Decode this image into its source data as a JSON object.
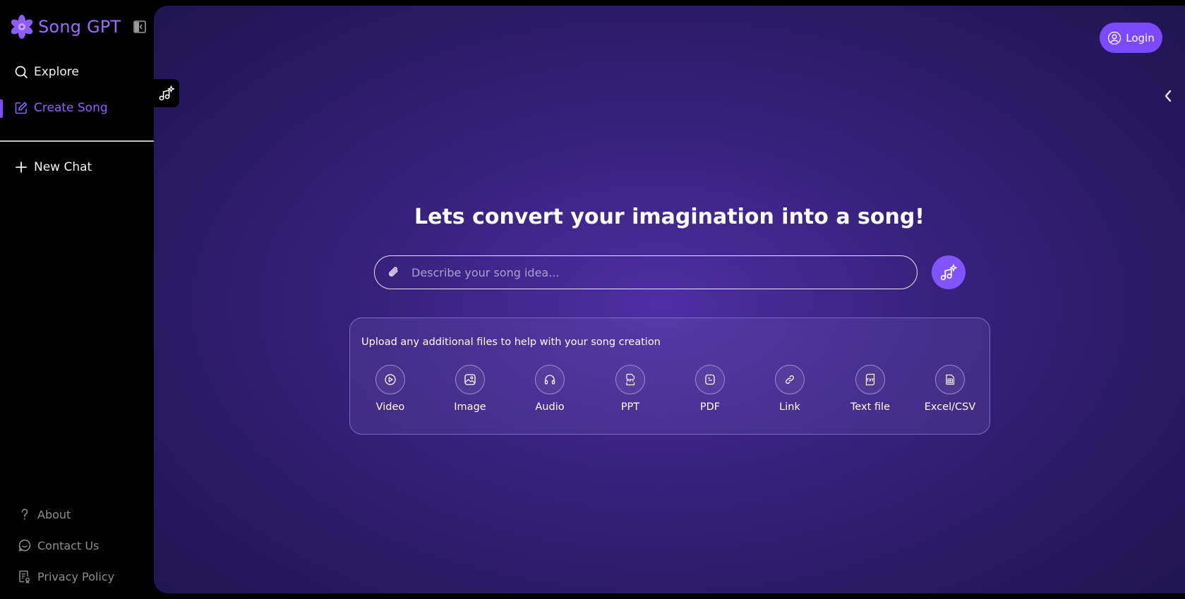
{
  "brand": {
    "name": "Song GPT"
  },
  "sidebar": {
    "items": [
      {
        "label": "Explore",
        "icon": "search-icon"
      },
      {
        "label": "Create Song",
        "icon": "edit-icon",
        "active": true
      }
    ],
    "new_chat": {
      "label": "New Chat",
      "icon": "plus-icon"
    },
    "footer": [
      {
        "label": "About",
        "icon": "question-icon"
      },
      {
        "label": "Contact Us",
        "icon": "chat-bubble-icon"
      },
      {
        "label": "Privacy Policy",
        "icon": "document-icon"
      }
    ]
  },
  "header": {
    "login_label": "Login"
  },
  "main": {
    "title": "Lets convert your imagination into a song!",
    "prompt": {
      "placeholder": "Describe your song idea...",
      "value": ""
    },
    "upload": {
      "title": "Upload any additional files to help with your song creation",
      "options": [
        {
          "label": "Video",
          "icon": "video-play-icon"
        },
        {
          "label": "Image",
          "icon": "image-icon"
        },
        {
          "label": "Audio",
          "icon": "headphones-icon"
        },
        {
          "label": "PPT",
          "icon": "ppt-file-icon"
        },
        {
          "label": "PDF",
          "icon": "pdf-file-icon"
        },
        {
          "label": "Link",
          "icon": "link-icon"
        },
        {
          "label": "Text file",
          "icon": "txt-file-icon"
        },
        {
          "label": "Excel/CSV",
          "icon": "spreadsheet-icon"
        }
      ]
    }
  },
  "colors": {
    "accent": "#7a4aff",
    "brand_text": "#9b6bff",
    "active_nav": "#8a60ff",
    "background_center": "#4f2ea3",
    "background_edge": "#1f1550"
  }
}
